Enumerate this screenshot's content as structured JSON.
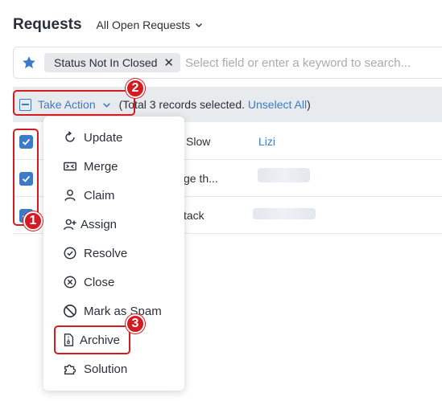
{
  "header": {
    "title": "Requests",
    "view_label": "All Open Requests"
  },
  "filter": {
    "chip_label": "Status Not In Closed",
    "chip_close": "✕",
    "placeholder": "Select field or enter a keyword to search..."
  },
  "action_bar": {
    "take_action_label": "Take Action",
    "selection_prefix": "(Total 3 records selected. ",
    "unselect_label": "Unselect All",
    "selection_suffix": ")"
  },
  "rows": [
    {
      "subject_fragment": "Slow",
      "agent": "Lizi"
    },
    {
      "subject_fragment": "ge th..."
    },
    {
      "subject_fragment": "tack"
    }
  ],
  "menu": {
    "items": [
      {
        "label": "Update",
        "icon": "refresh-icon"
      },
      {
        "label": "Merge",
        "icon": "merge-icon"
      },
      {
        "label": "Claim",
        "icon": "user-icon"
      },
      {
        "label": "Assign",
        "icon": "user-plus-icon"
      },
      {
        "label": "Resolve",
        "icon": "check-circle-icon"
      },
      {
        "label": "Close",
        "icon": "x-circle-icon"
      },
      {
        "label": "Mark as Spam",
        "icon": "ban-icon"
      },
      {
        "label": "Archive",
        "icon": "archive-file-icon"
      },
      {
        "label": "Solution",
        "icon": "puzzle-icon"
      }
    ]
  },
  "annotations": {
    "badge_1": "1",
    "badge_2": "2",
    "badge_3": "3",
    "color": "#d31b22"
  },
  "colors": {
    "accent": "#3b7bc7",
    "action_bar_bg": "#e8ebee"
  }
}
